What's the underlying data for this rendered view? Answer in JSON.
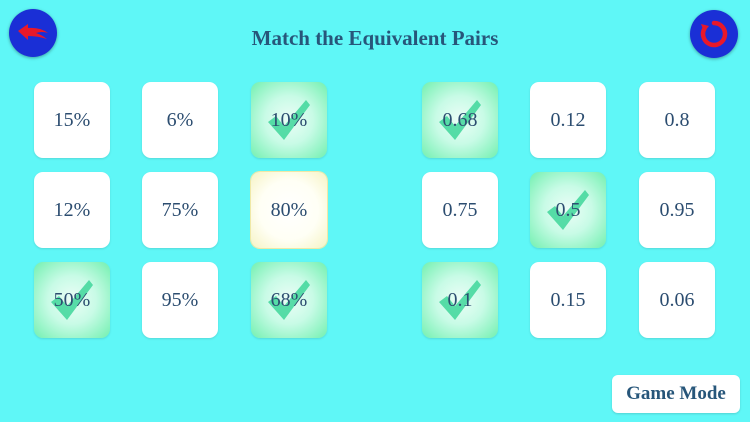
{
  "title": "Match the Equivalent Pairs",
  "icons": {
    "back": "back-arrow-icon",
    "restart": "restart-icon",
    "check": "checkmark-icon"
  },
  "colors": {
    "background": "#5ff7f7",
    "button_blue": "#1a2fd6",
    "icon_red": "#e8182a",
    "text": "#2c4d70",
    "matched_green": "#72f0b0",
    "selected_yellow": "#f6f3c4"
  },
  "percent_tiles": [
    {
      "label": "15%",
      "state": "normal"
    },
    {
      "label": "6%",
      "state": "normal"
    },
    {
      "label": "10%",
      "state": "matched"
    },
    {
      "label": "12%",
      "state": "normal"
    },
    {
      "label": "75%",
      "state": "normal"
    },
    {
      "label": "80%",
      "state": "selected"
    },
    {
      "label": "50%",
      "state": "matched"
    },
    {
      "label": "95%",
      "state": "normal"
    },
    {
      "label": "68%",
      "state": "matched"
    }
  ],
  "decimal_tiles": [
    {
      "label": "0.68",
      "state": "matched"
    },
    {
      "label": "0.12",
      "state": "normal"
    },
    {
      "label": "0.8",
      "state": "normal"
    },
    {
      "label": "0.75",
      "state": "normal"
    },
    {
      "label": "0.5",
      "state": "matched"
    },
    {
      "label": "0.95",
      "state": "normal"
    },
    {
      "label": "0.1",
      "state": "matched"
    },
    {
      "label": "0.15",
      "state": "normal"
    },
    {
      "label": "0.06",
      "state": "normal"
    }
  ],
  "game_mode_label": "Game Mode"
}
